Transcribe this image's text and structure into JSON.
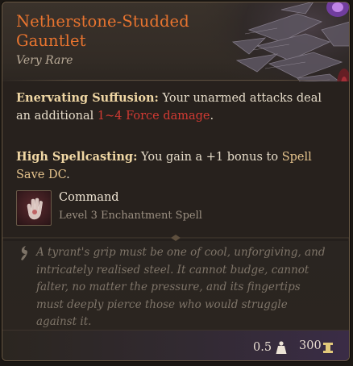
{
  "item": {
    "title": "Netherstone-Studded Gauntlet",
    "rarity": "Very Rare",
    "rarity_color": "#b9aa97",
    "title_color": "#e8742f"
  },
  "effects": [
    {
      "name": "Enervating Suffusion:",
      "text_before": " Your unarmed attacks deal an additional ",
      "damage": "1~4 Force damage",
      "text_after": "."
    },
    {
      "name": "High Spellcasting:",
      "text_before": " You gain a +1 bonus to ",
      "highlight": "Spell Save DC",
      "text_after": "."
    }
  ],
  "spell": {
    "icon": "open-palm-icon",
    "name": "Command",
    "subtitle": "Level 3 Enchantment Spell"
  },
  "lore": {
    "icon": "quote-icon",
    "text": "A tyrant's grip must be one of cool, unforgiving, and intricately realised steel. It cannot budge, cannot falter, no matter the pressure, and its fingertips must deeply pierce those who would struggle against it."
  },
  "footer": {
    "weight": "0.5",
    "weight_icon": "weight-icon",
    "price": "300",
    "price_icon": "gold-coin-icon"
  },
  "colors": {
    "damage": "#d33a33",
    "highlight": "#e6c48d",
    "effect_name": "#f0d7a4"
  }
}
